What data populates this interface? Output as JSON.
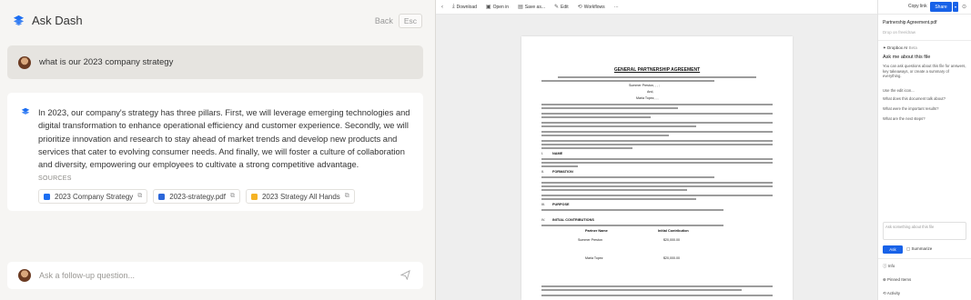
{
  "ask_dash": {
    "title": "Ask Dash",
    "back_label": "Back",
    "esc_label": "Esc",
    "query": "what is our 2023 company strategy",
    "answer": "In 2023, our company's strategy has three pillars. First, we will leverage emerging technologies and digital transformation to enhance operational efficiency and customer experience. Secondly, we will prioritize innovation and research to stay ahead of market trends and develop new products and services that cater to evolving consumer needs. And finally, we will foster a culture of collaboration and diversity, empowering our employees to cultivate a strong competitive advantage.",
    "sources_label": "SOURCES",
    "sources": [
      {
        "label": "2023 Company Strategy",
        "icon": "doc-icon",
        "color": "#1c6ef2"
      },
      {
        "label": "2023-strategy.pdf",
        "icon": "pdf-icon",
        "color": "#2b66d9"
      },
      {
        "label": "2023 Strategy All Hands",
        "icon": "slides-icon",
        "color": "#f5b324"
      }
    ],
    "followup_placeholder": "Ask a follow-up question...",
    "accent": "#1c6ef2"
  },
  "viewer": {
    "toolbar": {
      "download": "Download",
      "open": "Open in",
      "save": "Save as...",
      "edit": "Edit",
      "workflows": "Workflows",
      "more": "···"
    },
    "document": {
      "title": "GENERAL PARTNERSHIP AGREEMENT",
      "labels": {
        "name_a": "Summer Preston, , , ;",
        "and": "And,",
        "name_b": "Maria Topez, , ,",
        "s1": "I.",
        "h1": "NAME",
        "s2": "II.",
        "h2": "FORMATION",
        "s3": "III.",
        "h3": "PURPOSE",
        "s4": "IV.",
        "h4": "INITIAL CONTRIBUTIONS",
        "col1": "Partner Name",
        "col2": "Initial Contribution",
        "p1": "Summer Preston",
        "c1": "$20,000.00",
        "p2": "Maria Topez",
        "c2": "$20,000.00"
      }
    },
    "sidebar": {
      "copy_link": "Copy link",
      "share": "Share",
      "file_name": "Partnership Agreement.pdf",
      "doc_placeholder": "Drop on free/draw",
      "ai_label": "Dropbox AI",
      "beta": "Beta",
      "ask_heading": "Ask me about this file",
      "ask_desc": "You can ask questions about this file for answers, key takeaways, or create a summary of everything.",
      "suggestions": [
        "Use the edit icon...",
        "What does this document talk about?",
        "What were the important results?",
        "What are the next steps?"
      ],
      "input_placeholder": "Ask something about this file",
      "ask_button": "Ask",
      "summarize": "Summarize",
      "info": "Info",
      "pinned": "Pinned Items",
      "activity": "Activity"
    }
  }
}
